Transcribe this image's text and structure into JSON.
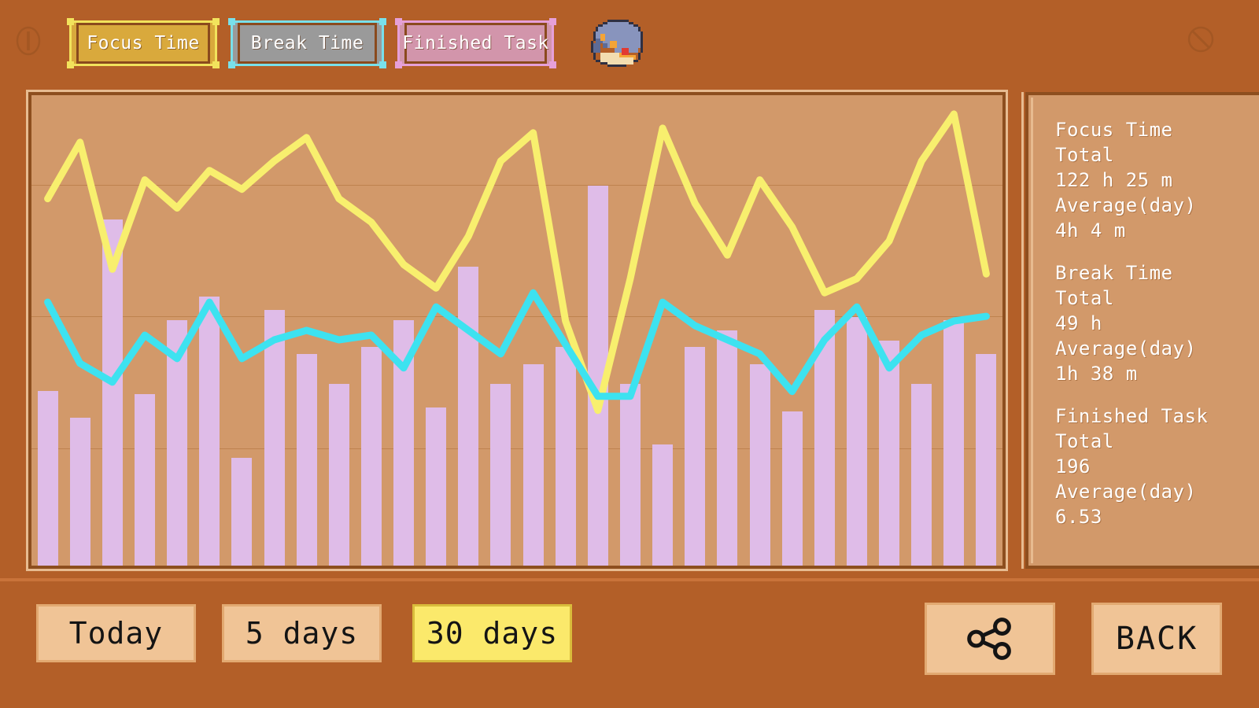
{
  "header": {
    "info_icon": "info-circle-icon",
    "block_icon": "no-entry-icon",
    "book_icon": "book-icon",
    "legend": [
      {
        "label": "Focus Time",
        "color": "#f2e35c",
        "fill": "#d9a93c"
      },
      {
        "label": "Break Time",
        "color": "#79e0ea",
        "fill": "#9a9a9a"
      },
      {
        "label": "Finished Task",
        "color": "#e6a0d8",
        "fill": "#d295ab"
      }
    ]
  },
  "stats": {
    "groups": [
      {
        "title": "Focus Time",
        "total_label": "Total",
        "total_value": "122 h 25 m",
        "average_label": "Average(day)",
        "average_value": "4h 4 m"
      },
      {
        "title": "Break Time",
        "total_label": "Total",
        "total_value": "49 h",
        "average_label": "Average(day)",
        "average_value": "1h 38 m"
      },
      {
        "title": "Finished Task",
        "total_label": "Total",
        "total_value": "196",
        "average_label": "Average(day)",
        "average_value": "6.53"
      }
    ]
  },
  "footer": {
    "range_buttons": [
      {
        "label": "Today",
        "active": false
      },
      {
        "label": "5 days",
        "active": false
      },
      {
        "label": "30 days",
        "active": true
      }
    ],
    "share_icon": "share-icon",
    "back_label": "BACK"
  },
  "chart_data": {
    "type": "bar",
    "title": "",
    "xlabel": "",
    "ylabel": "",
    "grid": true,
    "gridlines_y": [
      0.19,
      0.47,
      0.75
    ],
    "legend_position": "top",
    "categories": [
      "1",
      "2",
      "3",
      "4",
      "5",
      "6",
      "7",
      "8",
      "9",
      "10",
      "11",
      "12",
      "13",
      "14",
      "15",
      "16",
      "17",
      "18",
      "19",
      "20",
      "21",
      "22",
      "23",
      "24",
      "25",
      "26",
      "27",
      "28",
      "29",
      "30"
    ],
    "series": [
      {
        "name": "Finished Task",
        "type": "bar",
        "color": "#dfbce8",
        "ylim": [
          0,
          14
        ],
        "values": [
          5.2,
          4.4,
          10.3,
          5.1,
          7.3,
          8.0,
          3.2,
          7.6,
          6.3,
          5.4,
          6.5,
          7.3,
          4.7,
          8.9,
          5.4,
          6.0,
          6.5,
          11.3,
          5.4,
          3.6,
          6.5,
          7.0,
          6.0,
          4.6,
          7.6,
          7.4,
          6.7,
          5.4,
          7.3,
          6.3
        ]
      },
      {
        "name": "Focus Time",
        "type": "line",
        "color": "#f8ef6e",
        "ylim": [
          0,
          10
        ],
        "values": [
          7.8,
          9.0,
          6.3,
          8.2,
          7.6,
          8.4,
          8.0,
          8.6,
          9.1,
          7.8,
          7.3,
          6.4,
          5.9,
          7.0,
          8.6,
          9.2,
          5.2,
          3.3,
          6.1,
          9.3,
          7.7,
          6.6,
          8.2,
          7.2,
          5.8,
          6.1,
          6.9,
          8.6,
          9.6,
          6.2
        ]
      },
      {
        "name": "Break Time",
        "type": "line",
        "color": "#3de2f0",
        "ylim": [
          0,
          10
        ],
        "values": [
          5.6,
          4.3,
          3.9,
          4.9,
          4.4,
          5.6,
          4.4,
          4.8,
          5.0,
          4.8,
          4.9,
          4.2,
          5.5,
          5.0,
          4.5,
          5.8,
          4.7,
          3.6,
          3.6,
          5.6,
          5.1,
          4.8,
          4.5,
          3.7,
          4.8,
          5.5,
          4.2,
          4.9,
          5.2,
          5.3
        ]
      }
    ]
  }
}
